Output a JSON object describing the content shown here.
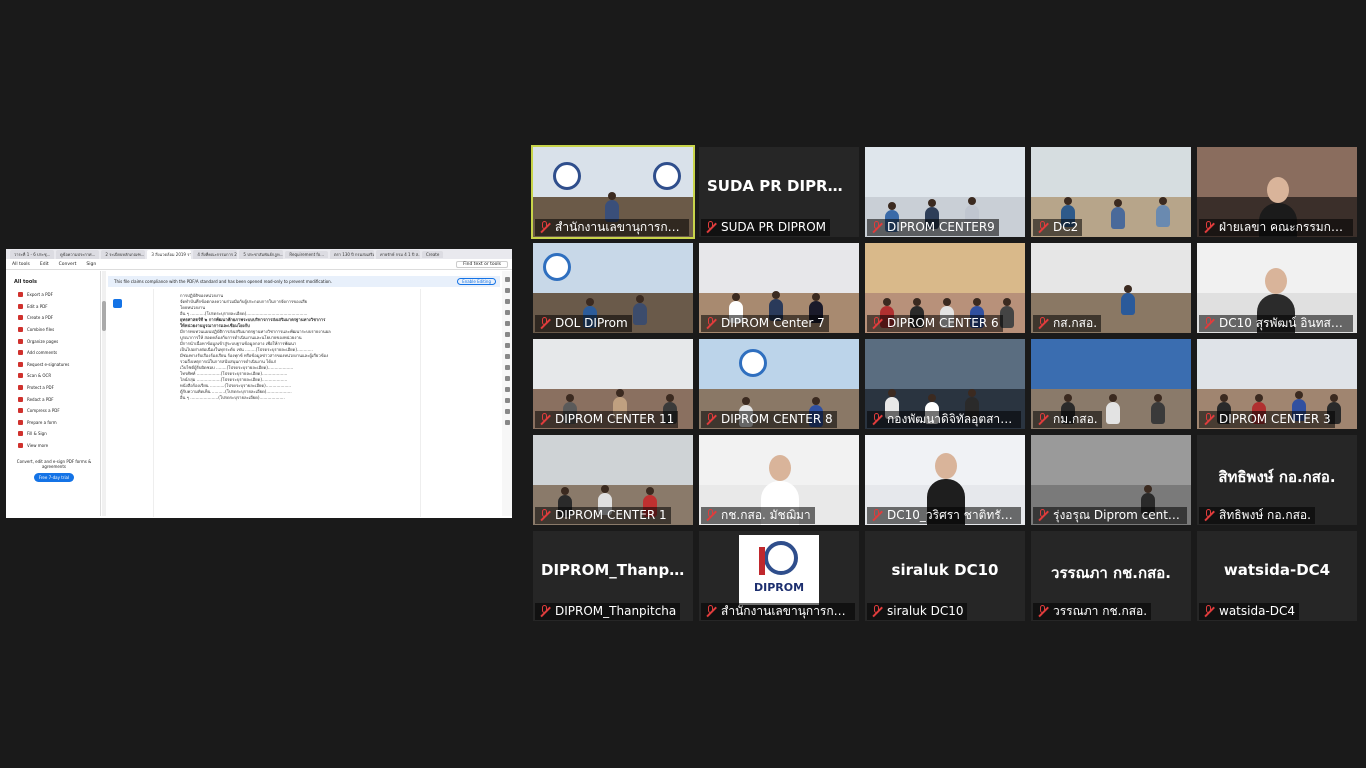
{
  "share": {
    "tabs": [
      "วาระที่ 1 - 6 ประชุ...",
      "ดูข้อความประกาศ...",
      "2 ระเบียบหลักเกณฑ...",
      "3 สิ่งแวดล้อม 2019 รายละ...",
      "4 สิ่งที่คณะกรรมการ 2...",
      "5 ประชาสัมพันธ์กฎห...",
      "Requirement fo...",
      "ตรา 130 ปี กรมส่งเสริม...",
      "ค่ายรักษ์ กรม 4 1 ปี ส...",
      "Create"
    ],
    "menu": [
      "All tools",
      "Edit",
      "Convert",
      "Sign"
    ],
    "find_text": "Find text or tools",
    "sidebar_title": "All tools",
    "tools": [
      "Export a PDF",
      "Edit a PDF",
      "Create a PDF",
      "Combine files",
      "Organize pages",
      "Add comments",
      "Request e-signatures",
      "Scan & OCR",
      "Protect a PDF",
      "Redact a PDF",
      "Compress a PDF",
      "Prepare a form",
      "Fill & Sign",
      "View more"
    ],
    "promo": "Convert, edit and e-sign PDF forms & agreements",
    "trial_label": "Free 7-day trial",
    "banner": "This file claims compliance with the PDF/A standard and has been opened read-only to prevent modification.",
    "enable_label": "Enable Editing",
    "doc_lines": [
      "การปฏิบัติของหน่วยงาน",
      "จัดทำบันทึกข้อตกลงความร่วมมือกับผู้ประกอบการในการจัดการของเสีย",
      "โดยหน่วยงาน",
      "อื่น ๆ ...........(โปรดระบุรายละเอียด)..............................................",
      "ยุทธศาสตร์ที่ ๒ การพัฒนาศักยภาพระบบบริหารการส่งเสริมมาตรฐานทางวิชาการ",
      "ให้หน่วยงานบูรณาการและเชื่อมโยงกับ",
      "มีการทบทวนแผนปฏิบัติการส่งเสริมมาตรฐานทางวิชาการและพัฒนาระบบรายงานผล",
      "บูรณาการให้ สอดคล้องกับการดำเนินงานและนโยบายของหน่วยงาน",
      "มีการนำเนื้อหาข้อมูลเข้าสู่ระบบฐานข้อมูลกลาง เพื่อให้การพัฒนา",
      "เป็นไปอย่างต่อเนื่องในทุกระดับ เช่น ........(โปรดระบุรายละเอียด)............",
      "มีช่องทางรับเรื่องร้องเรียน ร้องทุกข์ หรือข้อมูลข่าวสารของหน่วยงานและผู้เกี่ยวข้อง",
      "รวมถึงเหตุการณ์ในการสนับสนุนการดำเนินงาน ได้แก่",
      "เว็บไซต์ผู้รับผิดชอบ ........(โปรดระบุรายละเอียด)...................",
      "โทรศัพท์ ..................(โปรดระบุรายละเอียด)...................",
      "ไลน์กลุ่ม ..................(โปรดระบุรายละเอียด)...................",
      "หนังสือร้องเรียน ...........(โปรดระบุรายละเอียด)...................",
      "ตู้รับความคิดเห็น ..........(โปรดระบุรายละเอียด)...................",
      "อื่น ๆ .....................(โปรดระบุรายละเอียด)..................."
    ]
  },
  "tiles": [
    {
      "name": "สำนักงานเลขานุการกรม กรมส่งเสริม...",
      "type": "video",
      "speaker": true,
      "scene": "office_logo"
    },
    {
      "name": "SUDA PR DIPROM",
      "type": "avatar",
      "display": "SUDA PR DIPROM"
    },
    {
      "name": "DIPROM CENTER9",
      "type": "video",
      "scene": "room_light"
    },
    {
      "name": "DC2",
      "type": "video",
      "scene": "room_wide"
    },
    {
      "name": "ฝ่ายเลขา คณะกรรมการจริยธรรม...",
      "type": "video",
      "scene": "woman_mask"
    },
    {
      "name": "DOL DIProm",
      "type": "video",
      "scene": "room_blue"
    },
    {
      "name": "DIPROM Center 7",
      "type": "video",
      "scene": "meeting_table"
    },
    {
      "name": "DIPROM CENTER 6",
      "type": "video",
      "scene": "group_orange"
    },
    {
      "name": "กส.กสอ.",
      "type": "video",
      "scene": "office_desk"
    },
    {
      "name": "DC10 สุรพัฒน์ อินทสมบัติ",
      "type": "video",
      "scene": "headset"
    },
    {
      "name": "DIPROM CENTER 11",
      "type": "video",
      "scene": "room_white"
    },
    {
      "name": "DIPROM CENTER 8",
      "type": "video",
      "scene": "stage_blue"
    },
    {
      "name": "กองพัฒนาดิจิทัลอุตสาหกรรม...",
      "type": "video",
      "scene": "computers"
    },
    {
      "name": "กม.กสอ.",
      "type": "video",
      "scene": "conference_blue"
    },
    {
      "name": "DIPROM CENTER 3",
      "type": "video",
      "scene": "room_people"
    },
    {
      "name": "DIPROM CENTER 1",
      "type": "video",
      "scene": "table_grey"
    },
    {
      "name": "กช.กสอ. มัชฌิมา",
      "type": "video",
      "scene": "woman_glasses"
    },
    {
      "name": "DC10_วริศรา ชาติทรัพย์...",
      "type": "video",
      "scene": "woman_banner"
    },
    {
      "name": "รุ่งอรุณ Diprom center5",
      "type": "video",
      "scene": "blurry"
    },
    {
      "name": "สิทธิพงษ์ กอ.กสอ.",
      "type": "avatar",
      "display": "สิทธิพงษ์ กอ.กสอ."
    },
    {
      "name": "DIPROM_Thanpitcha",
      "type": "avatar",
      "display": "DIPROM_Thanpi..."
    },
    {
      "name": "สำนักงานเลขานุการกรม กรมส่งเสริม...",
      "type": "logo",
      "display": "DIPROM"
    },
    {
      "name": "siraluk DC10",
      "type": "avatar",
      "display": "siraluk DC10"
    },
    {
      "name": "วรรณภา กช.กสอ.",
      "type": "avatar",
      "display": "วรรณภา กช.กสอ."
    },
    {
      "name": "watsida-DC4",
      "type": "avatar",
      "display": "watsida-DC4"
    }
  ],
  "colors": {
    "background": "#1a1a1a",
    "tile": "#262626",
    "speaker_outline": "#c8d44a",
    "mic_muted": "#e03c3c",
    "acrobat_blue": "#1473e6"
  },
  "icons": {
    "muted": "mic-muted-icon"
  }
}
